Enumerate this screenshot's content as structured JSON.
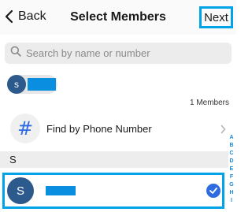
{
  "header": {
    "back_label": "Back",
    "title": "Select Members",
    "next_label": "Next"
  },
  "search": {
    "placeholder": "Search by name or number"
  },
  "selected": [
    {
      "initial": "s",
      "name": ""
    }
  ],
  "members_count": "1 Members",
  "find_phone": {
    "icon": "#",
    "label": "Find by Phone Number"
  },
  "section": {
    "letter": "S"
  },
  "contacts": [
    {
      "initial": "S",
      "name": "",
      "selected": true
    }
  ],
  "alphabet_index": [
    "A",
    "B",
    "C",
    "D",
    "E",
    "F",
    "G",
    "H",
    "I"
  ],
  "colors": {
    "accent": "#00a2e8",
    "avatar": "#2c5a8c",
    "check": "#2f6be0",
    "index": "#1e8ad8"
  }
}
